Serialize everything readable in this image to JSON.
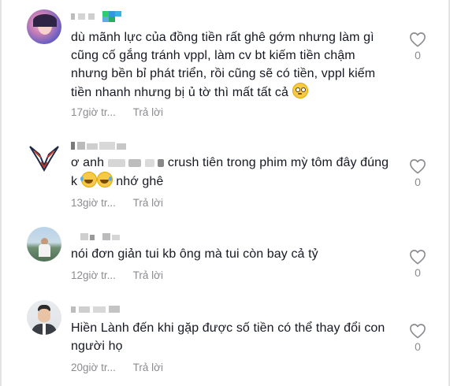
{
  "comments": [
    {
      "text_a": "dù mãnh lực của đồng tiền rất ghê gớm nhưng làm gì cũng cố gắng tránh vppl, làm cv bt kiếm tiền chậm nhưng bền bỉ phát triển, rồi cũng sẽ có tiền, vppl kiếm tiền nhanh nhưng bị ủ tờ thì mất tất cả",
      "time": "17giờ tr...",
      "reply": "Trả lời",
      "likes": "0",
      "emoji": "flushed-face-emoji"
    },
    {
      "text_a": "ơ anh",
      "text_b": "crush tiên trong phim mỳ tôm đây đúng k",
      "text_c": "nhớ ghê",
      "time": "13giờ tr...",
      "reply": "Trả lời",
      "likes": "0",
      "emoji": "tears-of-joy-emoji"
    },
    {
      "text_a": "nói đơn giản tui kb ông mà tui còn bay cả tỷ",
      "time": "12giờ tr...",
      "reply": "Trả lời",
      "likes": "0"
    },
    {
      "text_a": "Hiền Lành đến khi gặp được số tiền có thể thay đổi con người họ",
      "time": "20giờ tr...",
      "reply": "Trả lời",
      "likes": "0"
    }
  ],
  "colors": {
    "text": "#161823",
    "muted": "#8a8b91",
    "heart_stroke": "#8a8b91"
  }
}
